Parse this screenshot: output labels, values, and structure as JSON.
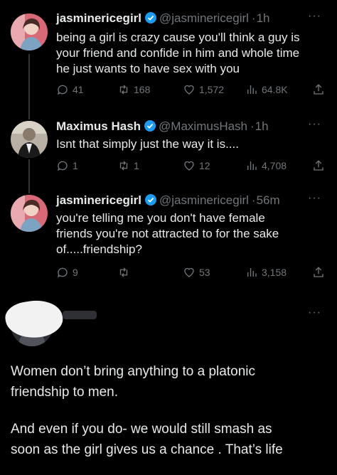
{
  "tweets": [
    {
      "name": "jasminericegirl",
      "handle": "@jasminericegirl",
      "time": "1h",
      "text_lines": [
        "being a girl is crazy cause you'll think a guy is",
        "your friend and confide in him and whole time",
        "he just wants to have sex with you"
      ],
      "replies": "41",
      "reposts": "168",
      "likes": "1,572",
      "views": "64.8K"
    },
    {
      "name": "Maximus Hash",
      "handle": "@MaximusHash",
      "time": "1h",
      "text_lines": [
        "Isnt that simply just the way it is...."
      ],
      "replies": "1",
      "reposts": "1",
      "likes": "12",
      "views": "4,708"
    },
    {
      "name": "jasminericegirl",
      "handle": "@jasminericegirl",
      "time": "56m",
      "text_lines": [
        "you're telling me you don't have female",
        "friends you're not attracted to for the sake",
        "of.....friendship?"
      ],
      "replies": "9",
      "reposts": "",
      "likes": "53",
      "views": "3,158"
    }
  ],
  "final_reply": {
    "paragraph_1_lines": [
      "Women don’t bring anything to a platonic",
      "friendship to men."
    ],
    "paragraph_2_lines": [
      "And even if you do- we would still smash as",
      "soon as the girl gives us a chance . That’s life"
    ]
  },
  "separator": "·",
  "more_glyph": "···",
  "colors": {
    "background": "#000000",
    "text": "#e7e9ea",
    "muted": "#71767b",
    "verified": "#1d9bf0"
  },
  "icons": [
    "verified-badge-icon",
    "reply-icon",
    "repost-icon",
    "like-icon",
    "views-icon",
    "share-icon",
    "more-icon"
  ]
}
